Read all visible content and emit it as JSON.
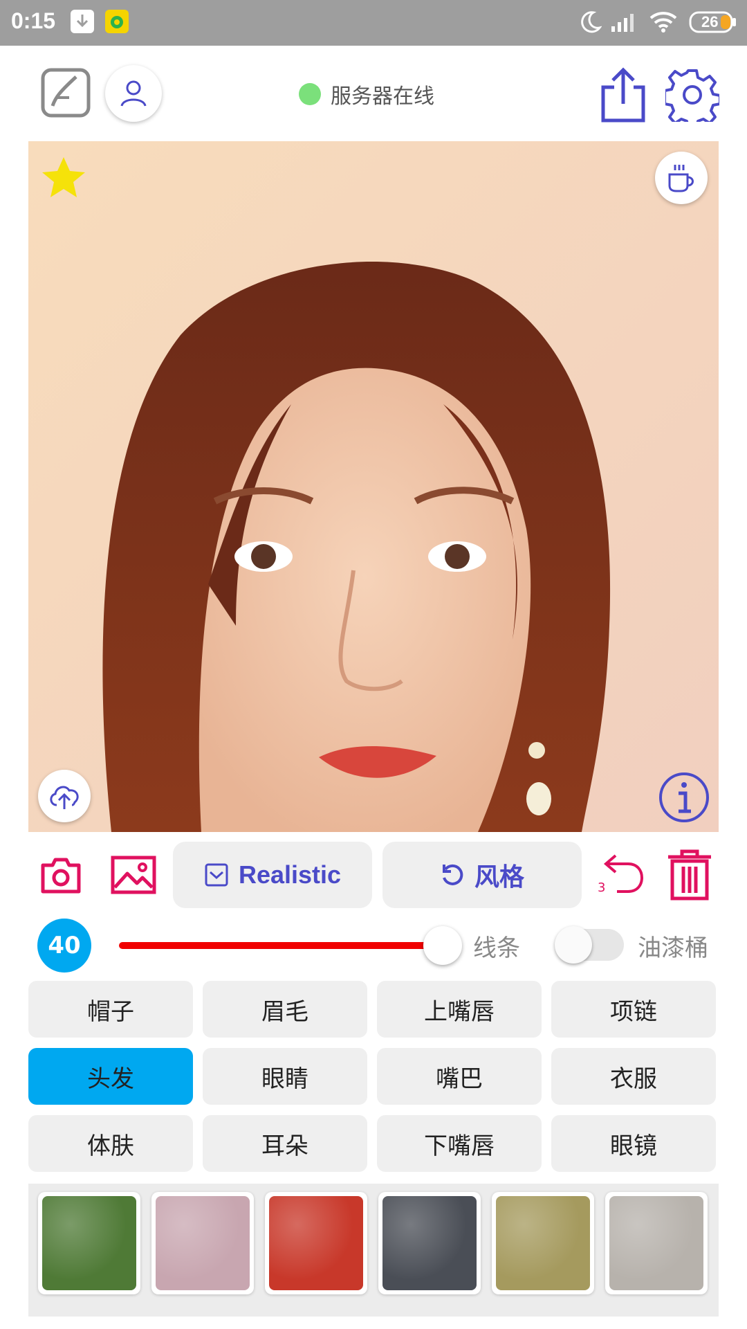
{
  "status_bar": {
    "time": "0:15",
    "battery": "26",
    "icons": [
      "download-icon",
      "music-app-icon",
      "moon-icon",
      "signal-icon",
      "wifi-icon",
      "battery-icon"
    ]
  },
  "header": {
    "server_status": "服务器在线",
    "server_status_color": "#7be07b",
    "icons": [
      "edit-sketch-icon",
      "user-icon",
      "share-icon",
      "gear-icon"
    ]
  },
  "photo": {
    "overlay_icons": [
      "star-icon",
      "coffee-icon",
      "cloud-upload-icon",
      "info-icon"
    ],
    "star_color": "#f5e20a"
  },
  "toolbar": {
    "model_label": "Realistic",
    "style_label": "风格",
    "undo_count": "3",
    "accent_color": "#e0115f",
    "icons": [
      "camera-icon",
      "gallery-icon",
      "undo-icon",
      "trash-icon"
    ]
  },
  "brush": {
    "size": "40",
    "slider_value_percent": 100,
    "line_label": "线条",
    "paint_bucket_label": "油漆桶",
    "paint_bucket_enabled": false
  },
  "categories": [
    {
      "label": "帽子",
      "active": false
    },
    {
      "label": "眉毛",
      "active": false
    },
    {
      "label": "上嘴唇",
      "active": false
    },
    {
      "label": "项链",
      "active": false
    },
    {
      "label": "头发",
      "active": true
    },
    {
      "label": "眼睛",
      "active": false
    },
    {
      "label": "嘴巴",
      "active": false
    },
    {
      "label": "衣服",
      "active": false
    },
    {
      "label": "体肤",
      "active": false
    },
    {
      "label": "耳朵",
      "active": false
    },
    {
      "label": "下嘴唇",
      "active": false
    },
    {
      "label": "眼镜",
      "active": false
    }
  ],
  "textures": [
    {
      "name": "texture-green-foliage",
      "color": "#4f7a36"
    },
    {
      "name": "texture-lavender",
      "color": "#c8a6b0"
    },
    {
      "name": "texture-red-flowers",
      "color": "#c8382a"
    },
    {
      "name": "texture-dark-smoke",
      "color": "#4a4e56"
    },
    {
      "name": "texture-golden-grass",
      "color": "#a59a5e"
    },
    {
      "name": "texture-snow-rock",
      "color": "#b7b2ac"
    }
  ]
}
